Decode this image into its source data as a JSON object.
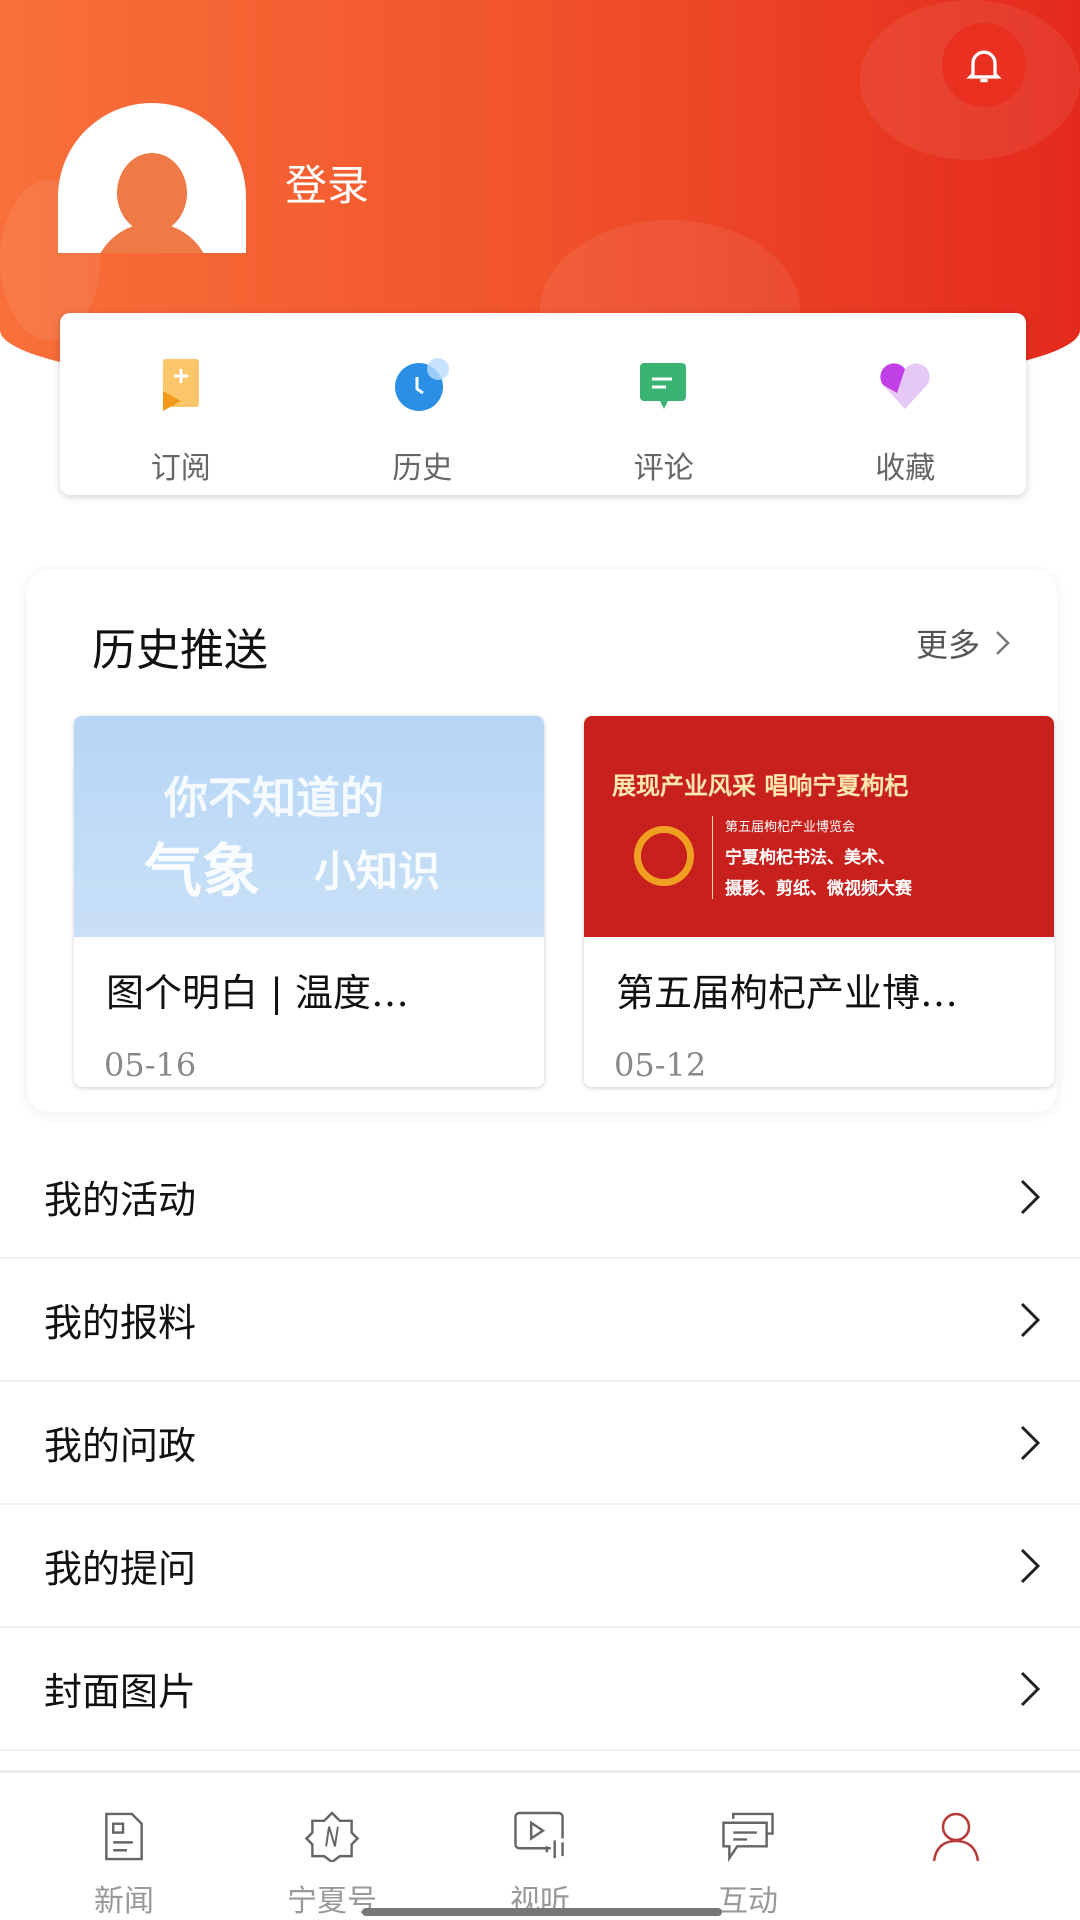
{
  "header": {
    "login_label": "登录",
    "bell_icon": "bell-icon",
    "gradient": [
      "#f8703a",
      "#e42a1d"
    ]
  },
  "quick_menu": [
    {
      "label": "订阅",
      "icon": "subscribe-icon"
    },
    {
      "label": "历史",
      "icon": "clock-icon"
    },
    {
      "label": "评论",
      "icon": "comment-icon"
    },
    {
      "label": "收藏",
      "icon": "heart-icon"
    }
  ],
  "history_push": {
    "title": "历史推送",
    "more_label": "更多",
    "items": [
      {
        "image_text": [
          "你不知道的",
          "气象",
          "小知识"
        ],
        "title": "图个明白 | 温度…",
        "date": "05-16"
      },
      {
        "image_text": [
          "展现产业风采 唱响宁夏枸杞",
          "第五届枸杞产业博览会",
          "宁夏枸杞书法、美术、",
          "摄影、剪纸、微视频大赛"
        ],
        "title": "第五届枸杞产业博…",
        "date": "05-12"
      }
    ]
  },
  "menu": [
    {
      "label": "我的活动"
    },
    {
      "label": "我的报料"
    },
    {
      "label": "我的问政"
    },
    {
      "label": "我的提问"
    },
    {
      "label": "封面图片"
    }
  ],
  "bottom_nav": [
    {
      "label": "新闻",
      "icon": "news-icon"
    },
    {
      "label": "宁夏号",
      "icon": "ningxia-hao-icon"
    },
    {
      "label": "视听",
      "icon": "video-icon"
    },
    {
      "label": "互动",
      "icon": "chat-icon"
    },
    {
      "label": "",
      "icon": "user-icon",
      "active": true
    }
  ],
  "colors": {
    "accent": "#e42a1d",
    "active_nav": "#c0392b"
  }
}
